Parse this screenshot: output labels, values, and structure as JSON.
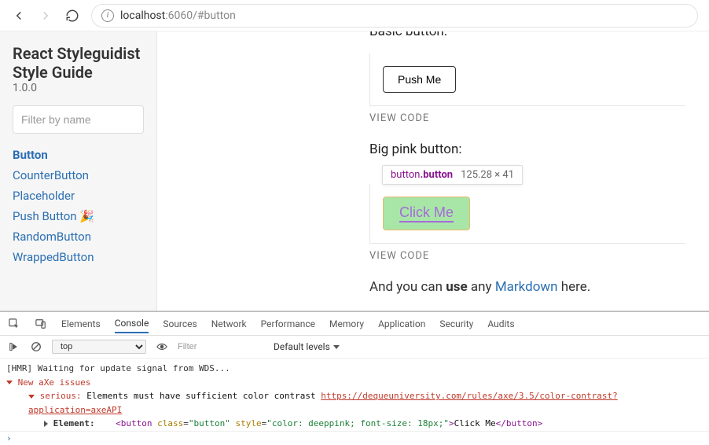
{
  "browser": {
    "url_host": "localhost",
    "url_port": ":6060",
    "url_path": "/#button"
  },
  "sidebar": {
    "title_line1": "React Styleguidist",
    "title_line2": "Style Guide",
    "version": "1.0.0",
    "filter_placeholder": "Filter by name",
    "items": [
      {
        "label": "Button",
        "emoji": ""
      },
      {
        "label": "CounterButton",
        "emoji": ""
      },
      {
        "label": "Placeholder",
        "emoji": ""
      },
      {
        "label": "Push Button ",
        "emoji": "🎉"
      },
      {
        "label": "RandomButton",
        "emoji": ""
      },
      {
        "label": "WrappedButton",
        "emoji": ""
      }
    ]
  },
  "content": {
    "basic_heading": "Basic button:",
    "push_label": "Push Me",
    "view_code": "VIEW CODE",
    "big_heading": "Big pink button:",
    "tooltip_selector_prefix": "button",
    "tooltip_selector_class": ".button",
    "tooltip_dims": "125.28 × 41",
    "click_label": "Click Me",
    "md_pre": "And you can ",
    "md_bold": "use",
    "md_mid": " any ",
    "md_link": "Markdown",
    "md_post": " here."
  },
  "devtools": {
    "tabs": [
      "Elements",
      "Console",
      "Sources",
      "Network",
      "Performance",
      "Memory",
      "Application",
      "Security",
      "Audits"
    ],
    "active_tab": "Console",
    "dropdown": "top",
    "filter_placeholder": "Filter",
    "levels": "Default levels",
    "console": {
      "hmr": "[HMR] Waiting for update signal from WDS...",
      "axe_header": "New aXe issues",
      "severity": "serious",
      "message": "Elements must have sufficient color contrast ",
      "link": "https://dequeuniversity.com/rules/axe/3.5/color-contrast?application=axeAPI",
      "element_label": "Element:",
      "element_html_open": "<button ",
      "element_class_attr": "class",
      "element_class_val": "\"button\"",
      "element_style_attr": "style",
      "element_style_val": "\"color: deeppink; font-size: 18px;\"",
      "element_close": ">",
      "element_text": "Click Me",
      "element_end": "</button>"
    }
  }
}
